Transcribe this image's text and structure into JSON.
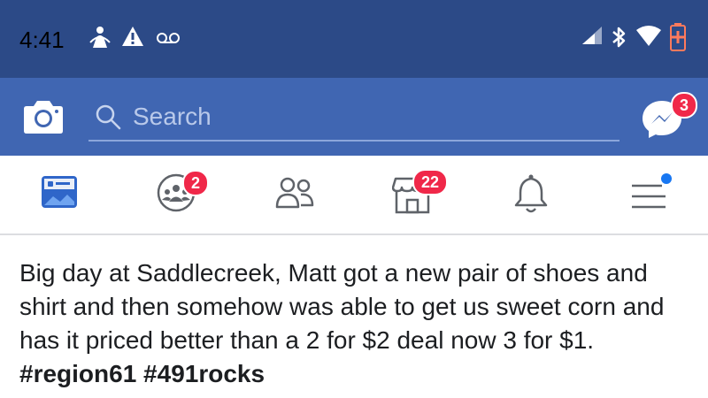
{
  "status": {
    "time": "4:41",
    "left_icons": [
      "tethering-icon",
      "warning-icon",
      "voicemail-icon"
    ],
    "right_icons": [
      "signal-icon",
      "bluetooth-icon",
      "wifi-icon",
      "battery-icon"
    ]
  },
  "appbar": {
    "search_placeholder": "Search",
    "messenger_badge": "3"
  },
  "nav": {
    "items": [
      {
        "name": "news-feed",
        "badge": ""
      },
      {
        "name": "groups",
        "badge": "2"
      },
      {
        "name": "friends",
        "badge": ""
      },
      {
        "name": "marketplace",
        "badge": "22"
      },
      {
        "name": "notifications",
        "badge": ""
      },
      {
        "name": "menu",
        "badge": ""
      }
    ]
  },
  "post": {
    "text": "Big day at Saddlecreek, Matt got a new pair of shoes and shirt and then somehow was able to get us sweet corn and has it priced better than a 2 for $2 deal now 3 for $1.",
    "hashtags": "#region61 #491rocks"
  },
  "colors": {
    "status_bar": "#2c4a87",
    "app_bar": "#4066b2",
    "badge": "#f02849",
    "menu_dot": "#1877f2"
  }
}
